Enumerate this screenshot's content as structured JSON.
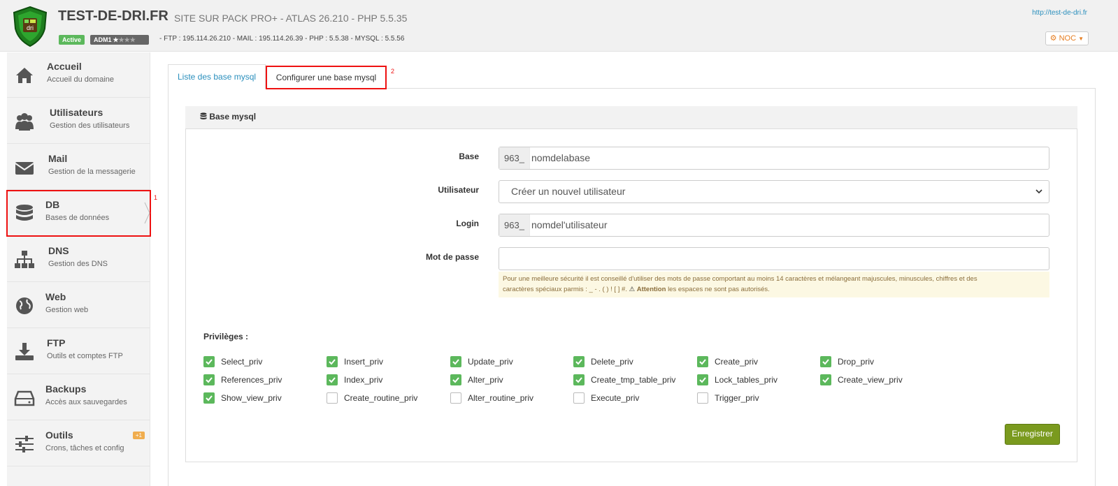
{
  "header": {
    "site_title": "TEST-DE-DRI.FR",
    "site_subtitle": "SITE SUR PACK PRO+ - ATLAS 26.210 - PHP 5.5.35",
    "status_badge": "Active",
    "admin_badge": "ADM1",
    "server_info": "- FTP : 195.114.26.210 - MAIL : 195.114.26.39 - PHP : 5.5.38 - MYSQL : 5.5.56",
    "site_url": "http://test-de-dri.fr",
    "noc_label": "NOC",
    "logo_text": "dri"
  },
  "sidebar": {
    "items": [
      {
        "title": "Accueil",
        "subtitle": "Accueil du domaine",
        "icon": "home-icon"
      },
      {
        "title": "Utilisateurs",
        "subtitle": "Gestion des utilisateurs",
        "icon": "users-icon"
      },
      {
        "title": "Mail",
        "subtitle": "Gestion de la messagerie",
        "icon": "envelope-icon"
      },
      {
        "title": "DB",
        "subtitle": "Bases de données",
        "icon": "database-icon"
      },
      {
        "title": "DNS",
        "subtitle": "Gestion des DNS",
        "icon": "sitemap-icon"
      },
      {
        "title": "Web",
        "subtitle": "Gestion web",
        "icon": "globe-icon"
      },
      {
        "title": "FTP",
        "subtitle": "Outils et comptes FTP",
        "icon": "download-icon"
      },
      {
        "title": "Backups",
        "subtitle": "Accès aux sauvegardes",
        "icon": "hdd-icon"
      },
      {
        "title": "Outils",
        "subtitle": "Crons, tâches et config",
        "icon": "sliders-icon",
        "badge": "+1"
      }
    ],
    "annotation": "1"
  },
  "tabs": {
    "list": "Liste des base mysql",
    "configure": "Configurer une base mysql",
    "annotation": "2"
  },
  "panel": {
    "title": "Base mysql",
    "fields": {
      "base_label": "Base",
      "base_prefix": "963_",
      "base_value": "nomdelabase",
      "user_label": "Utilisateur",
      "user_selected": "Créer un nouvel utilisateur",
      "login_label": "Login",
      "login_prefix": "963_",
      "login_value": "nomdel'utilisateur",
      "password_label": "Mot de passe",
      "password_value": ""
    },
    "hint_line1": "Pour une meilleure sécurité il est conseillé d'utiliser des mots de passe comportant au moins 14 caractères et mélangeant majuscules, minuscules, chiffres et des",
    "hint_line2_start": "caractères spéciaux parmis : _ - . ( ) ! [ ] #.",
    "hint_attention": "Attention",
    "hint_line2_end": "les espaces ne sont pas autorisés.",
    "privileges_label": "Privilèges :",
    "privileges": [
      {
        "name": "Select_priv",
        "checked": true
      },
      {
        "name": "Insert_priv",
        "checked": true
      },
      {
        "name": "Update_priv",
        "checked": true
      },
      {
        "name": "Delete_priv",
        "checked": true
      },
      {
        "name": "Create_priv",
        "checked": true
      },
      {
        "name": "Drop_priv",
        "checked": true
      },
      {
        "name": "References_priv",
        "checked": true
      },
      {
        "name": "Index_priv",
        "checked": true
      },
      {
        "name": "Alter_priv",
        "checked": true
      },
      {
        "name": "Create_tmp_table_priv",
        "checked": true
      },
      {
        "name": "Lock_tables_priv",
        "checked": true
      },
      {
        "name": "Create_view_priv",
        "checked": true
      },
      {
        "name": "Show_view_priv",
        "checked": true
      },
      {
        "name": "Create_routine_priv",
        "checked": false
      },
      {
        "name": "Alter_routine_priv",
        "checked": false
      },
      {
        "name": "Execute_priv",
        "checked": false
      },
      {
        "name": "Trigger_priv",
        "checked": false
      }
    ],
    "save_label": "Enregistrer"
  },
  "colors": {
    "accent": "#2a8fbd",
    "success": "#5cb85c",
    "save_button": "#7a9a1e",
    "highlight": "#e11111",
    "noc": "#e67e22"
  }
}
